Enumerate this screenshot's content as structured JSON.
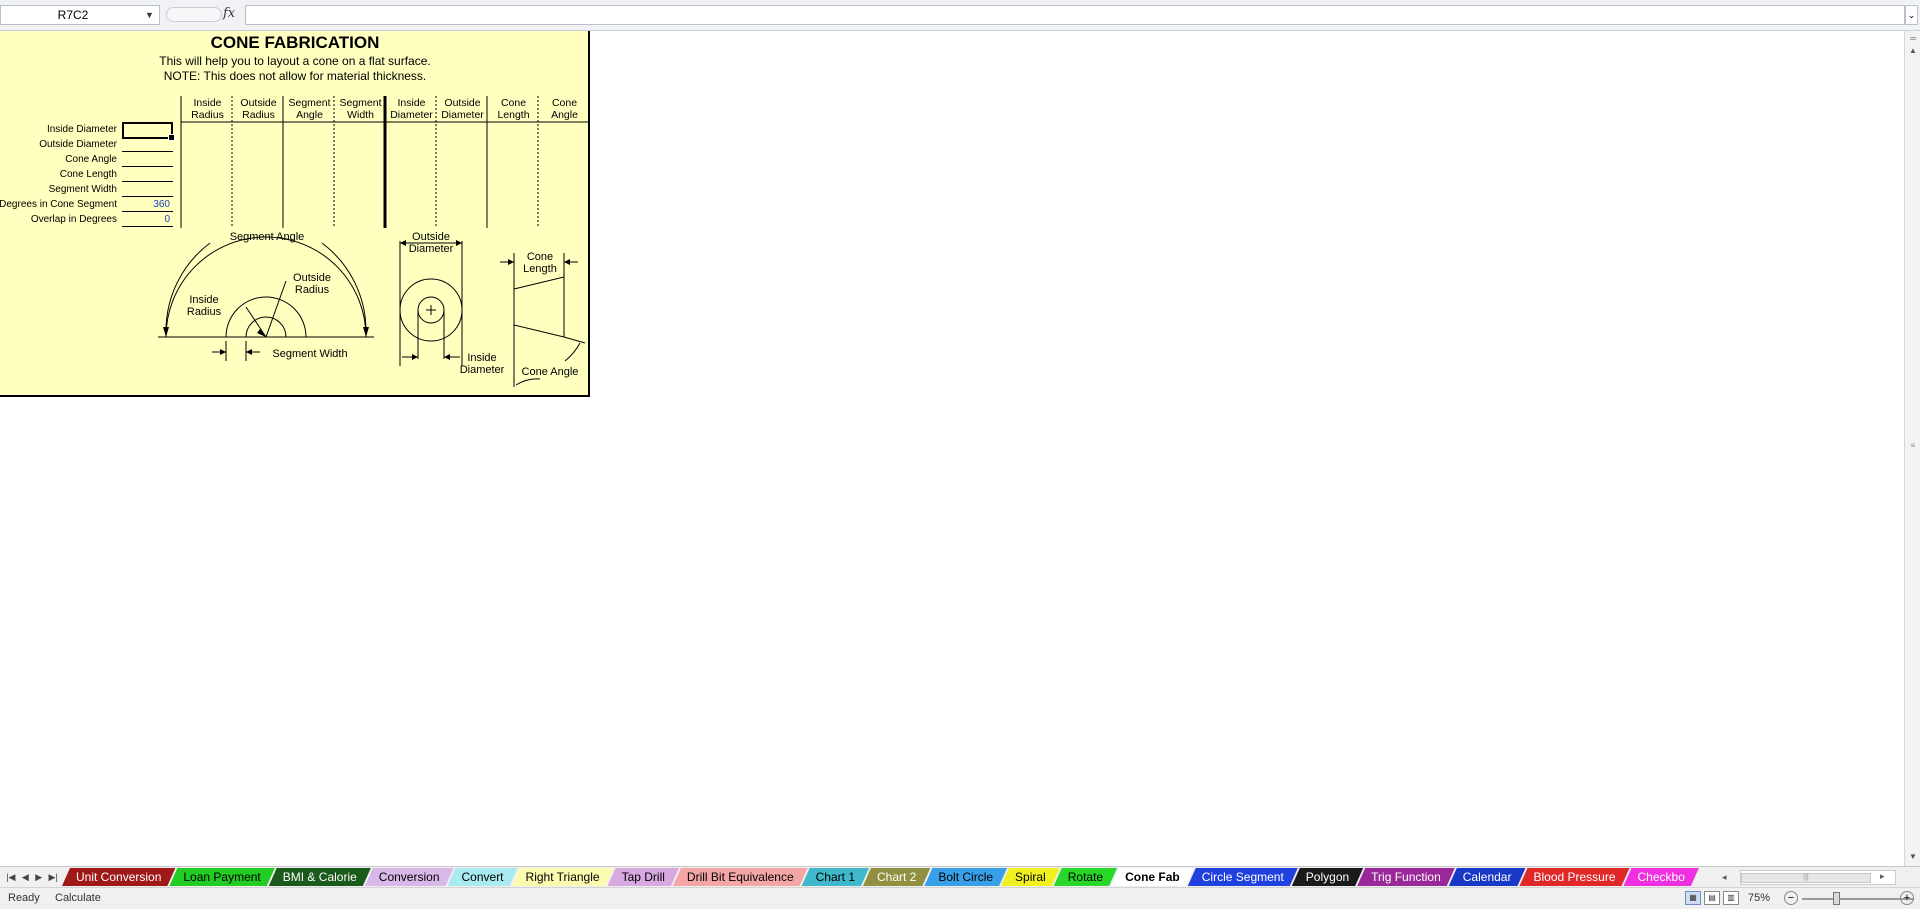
{
  "formula_bar": {
    "name_box": "R7C2",
    "fx_label": "fx",
    "formula_value": ""
  },
  "sheet": {
    "title": "CONE FABRICATION",
    "subtitle_1": "This will help you to layout a cone on a flat surface.",
    "subtitle_2": "NOTE: This does not allow for material thickness.",
    "inputs": [
      {
        "label": "Inside Diameter",
        "value": "",
        "active": true
      },
      {
        "label": "Outside Diameter",
        "value": ""
      },
      {
        "label": "Cone Angle",
        "value": ""
      },
      {
        "label": "Cone Length",
        "value": ""
      },
      {
        "label": "Segment Width",
        "value": ""
      },
      {
        "label": "Degrees in Cone Segment",
        "value": "360"
      },
      {
        "label": "Overlap in Degrees",
        "value": "0"
      }
    ],
    "result_columns": [
      {
        "line1": "Inside",
        "line2": "Radius"
      },
      {
        "line1": "Outside",
        "line2": "Radius"
      },
      {
        "line1": "Segment",
        "line2": "Angle"
      },
      {
        "line1": "Segment",
        "line2": "Width"
      },
      {
        "line1": "Inside",
        "line2": "Diameter"
      },
      {
        "line1": "Outside",
        "line2": "Diameter"
      },
      {
        "line1": "Cone",
        "line2": "Length"
      },
      {
        "line1": "Cone",
        "line2": "Angle"
      }
    ],
    "diagram_labels": {
      "segment_angle": "Segment  Angle",
      "inside_radius_1": "Inside",
      "inside_radius_2": "Radius",
      "outside_radius_1": "Outside",
      "outside_radius_2": "Radius",
      "segment_width": "Segment  Width",
      "outside_diameter_1": "Outside",
      "outside_diameter_2": "Diameter",
      "inside_diameter_1": "Inside",
      "inside_diameter_2": "Diameter",
      "cone_length_1": "Cone",
      "cone_length_2": "Length",
      "cone_angle": "Cone  Angle"
    }
  },
  "sheet_tabs": [
    {
      "label": "Unit Conversion",
      "bg": "#a01818",
      "fg": "#ffffff"
    },
    {
      "label": "Loan Payment",
      "bg": "#22cc22",
      "fg": "#000000"
    },
    {
      "label": "BMI & Calorie",
      "bg": "#1a5a1a",
      "fg": "#ffffff"
    },
    {
      "label": "Conversion",
      "bg": "#d8b8e8",
      "fg": "#000000"
    },
    {
      "label": "Convert",
      "bg": "#a8eaf0",
      "fg": "#000000"
    },
    {
      "label": "Right Triangle",
      "bg": "#fbfbb0",
      "fg": "#000000"
    },
    {
      "label": "Tap Drill",
      "bg": "#d8a8e0",
      "fg": "#000000"
    },
    {
      "label": "Drill Bit Equivalence",
      "bg": "#f4a6a6",
      "fg": "#000000"
    },
    {
      "label": "Chart 1",
      "bg": "#40b8cc",
      "fg": "#000000"
    },
    {
      "label": "Chart 2",
      "bg": "#909040",
      "fg": "#ffffff"
    },
    {
      "label": "Bolt Circle",
      "bg": "#38a0e8",
      "fg": "#000000"
    },
    {
      "label": "Spiral",
      "bg": "#f0f020",
      "fg": "#000000"
    },
    {
      "label": "Rotate",
      "bg": "#28d828",
      "fg": "#000000"
    },
    {
      "label": "Cone Fab",
      "bg": "#ffffff",
      "fg": "#000000",
      "active": true
    },
    {
      "label": "Circle Segment",
      "bg": "#2040e0",
      "fg": "#ffffff"
    },
    {
      "label": "Polygon",
      "bg": "#1a1a1a",
      "fg": "#ffffff"
    },
    {
      "label": "Trig Function",
      "bg": "#9a2898",
      "fg": "#ffffff"
    },
    {
      "label": "Calendar",
      "bg": "#1838c8",
      "fg": "#ffffff"
    },
    {
      "label": "Blood Pressure",
      "bg": "#e02828",
      "fg": "#ffffff"
    },
    {
      "label": "Checkbo",
      "bg": "#f030e0",
      "fg": "#ffffff"
    }
  ],
  "status_bar": {
    "ready": "Ready",
    "calculate": "Calculate",
    "zoom": "75%"
  },
  "icons": {
    "first_sheet": "first-sheet-icon",
    "prev_sheet": "prev-sheet-icon",
    "next_sheet": "next-sheet-icon",
    "last_sheet": "last-sheet-icon",
    "normal_view": "normal-view-icon",
    "page_layout": "page-layout-icon",
    "page_break": "page-break-icon"
  }
}
